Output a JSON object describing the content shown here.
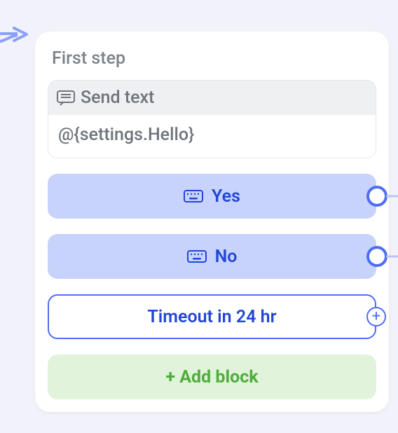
{
  "step": {
    "title": "First step",
    "sendText": {
      "headerLabel": "Send text",
      "body": "@{settings.Hello}"
    },
    "options": {
      "yes": "Yes",
      "no": "No"
    },
    "timeout": {
      "label": "Timeout in 24 hr"
    },
    "addBlock": {
      "label": "+ Add block"
    }
  }
}
